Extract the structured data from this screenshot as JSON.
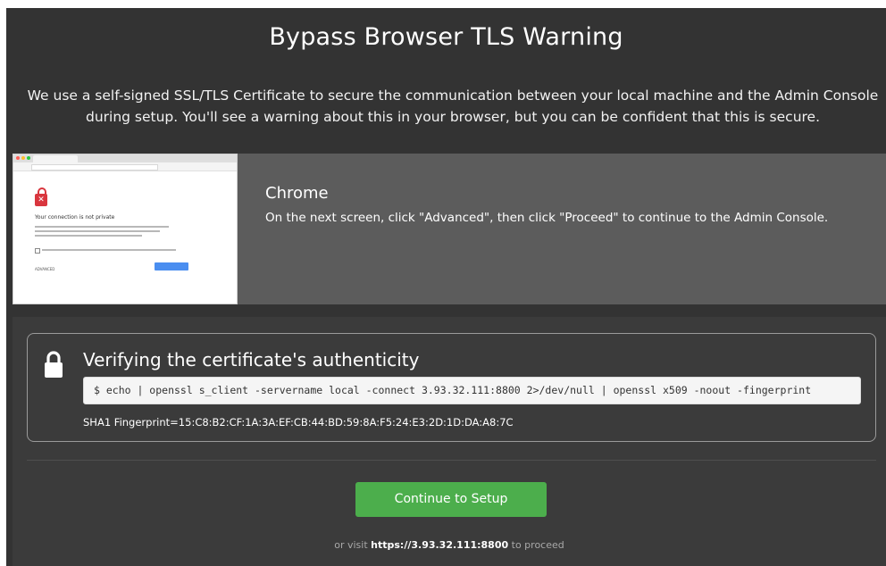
{
  "header": {
    "title": "Bypass Browser TLS Warning",
    "subtitle": "We use a self-signed SSL/TLS Certificate to secure the communication between your local machine and the Admin Console during setup. You'll see a warning about this in your browser, but you can be confident that this is secure."
  },
  "browser": {
    "name": "Chrome",
    "instruction": "On the next screen, click \"Advanced\", then click \"Proceed\" to continue to the Admin Console.",
    "thumbnail": {
      "heading": "Your connection is not private",
      "advanced": "ADVANCED"
    }
  },
  "verify": {
    "icon": "lock-icon",
    "title": "Verifying the certificate's authenticity",
    "command": "$ echo | openssl s_client -servername local -connect 3.93.32.111:8800 2>/dev/null | openssl x509 -noout -fingerprint",
    "fingerprint": "SHA1 Fingerprint=15:C8:B2:CF:1A:3A:EF:CB:44:BD:59:8A:F5:24:E3:2D:1D:DA:A8:7C"
  },
  "actions": {
    "continue_label": "Continue to Setup",
    "visit_prefix": "or visit ",
    "visit_url": "https://3.93.32.111:8800",
    "visit_suffix": " to proceed"
  },
  "colors": {
    "page_bg": "#333333",
    "browser_row_bg": "#5c5c5c",
    "button_green": "#4cae4c",
    "warning_red": "#d9363e"
  }
}
